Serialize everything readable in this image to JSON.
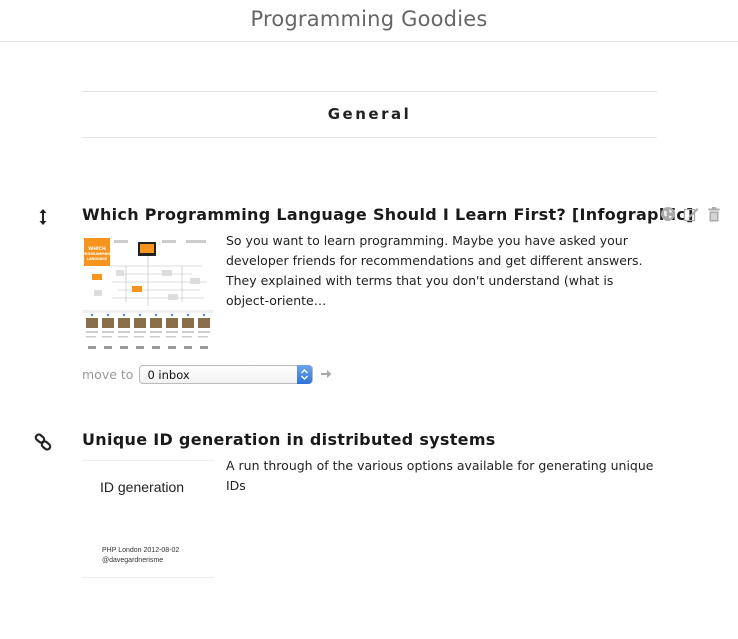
{
  "header": {
    "title": "Programming Goodies"
  },
  "section": {
    "title": "General"
  },
  "items": [
    {
      "title": "Which Programming Language Should I Learn First? [Infographic]",
      "excerpt": "So you want to learn programming. Maybe you have asked your developer friends for recommendations and get different answers. They explained with terms that you don't understand (what is object-oriente…",
      "side_icon": "move-vertical-icon",
      "thumb_text": "WHICH PROGRAMMING LANGUAGE",
      "move_label": "move to",
      "move_value": "0 inbox"
    },
    {
      "title": "Unique ID generation in distributed systems",
      "excerpt": "A run through of the various options available for generating unique IDs",
      "side_icon": "link-icon",
      "thumb": {
        "title": "ID generation",
        "sub1": "PHP London 2012-08-02",
        "sub2": "@davegardnerisme"
      }
    }
  ],
  "action_icons": [
    "globe-icon",
    "edit-icon",
    "trash-icon"
  ],
  "colors": {
    "accent": "#f7941d",
    "select_blue": "#2f72d6",
    "muted": "#999999"
  }
}
